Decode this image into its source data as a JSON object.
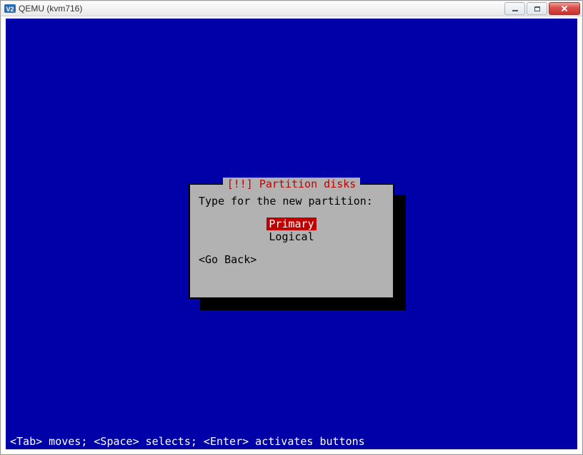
{
  "window": {
    "title": "QEMU (kvm716)"
  },
  "installer": {
    "dialog_title": "[!!] Partition disks",
    "prompt": "Type for the new partition:",
    "options": [
      "Primary",
      "Logical"
    ],
    "selected_index": 0,
    "go_back_label": "<Go Back>"
  },
  "help_bar": "<Tab> moves; <Space> selects; <Enter> activates buttons"
}
